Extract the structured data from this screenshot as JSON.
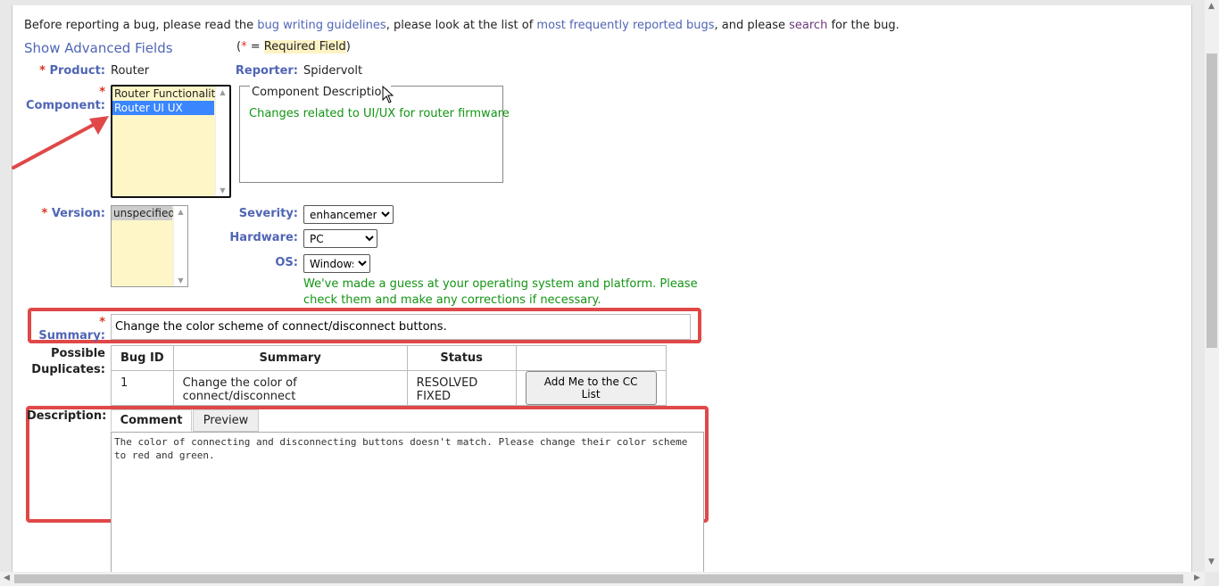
{
  "intro": {
    "t1": "Before reporting a bug, please read the ",
    "link_guidelines": "bug writing guidelines",
    "t2": ", please look at the list of ",
    "link_frequent": "most frequently reported bugs",
    "t3": ", and please ",
    "link_search": "search",
    "t4": " for the bug."
  },
  "show_advanced": "Show Advanced Fields",
  "required_note": {
    "open": "(",
    "star": "*",
    "eq": " = ",
    "text": "Required Field",
    "close": ")"
  },
  "product": {
    "star": "*",
    "label": "Product:",
    "value": "Router"
  },
  "reporter": {
    "label": "Reporter:",
    "value": "Spidervolt"
  },
  "component": {
    "star": "*",
    "label": "Component:",
    "options": [
      "Router Functionality",
      "Router UI UX"
    ],
    "selected": "Router UI UX"
  },
  "component_description": {
    "legend": "Component Description",
    "text": "Changes related to UI/UX for router firmware"
  },
  "version": {
    "star": "*",
    "label": "Version:",
    "options": [
      "unspecified"
    ]
  },
  "severity": {
    "label": "Severity:",
    "value": "enhancement"
  },
  "hardware": {
    "label": "Hardware:",
    "value": "PC"
  },
  "os": {
    "label": "OS:",
    "value": "Windows"
  },
  "guess_note": "We've made a guess at your operating system and platform. Please check them and make any corrections if necessary.",
  "summary": {
    "star": "*",
    "label": "Summary:",
    "value": "Change the color scheme of connect/disconnect buttons."
  },
  "duplicates": {
    "label_line1": "Possible",
    "label_line2": "Duplicates:",
    "headers": [
      "Bug ID",
      "Summary",
      "Status",
      ""
    ],
    "rows": [
      {
        "id": "1",
        "summary": "Change the color of connect/disconnect",
        "status": "RESOLVED FIXED",
        "action": "Add Me to the CC List"
      }
    ]
  },
  "description": {
    "label": "Description:",
    "tabs": [
      "Comment",
      "Preview"
    ],
    "comment": "The color of connecting and disconnecting buttons doesn't match. Please change their color scheme to red and green."
  },
  "colors": {
    "link": "#5065b5",
    "required": "#d32222",
    "highlight_box": "#e04848",
    "note_green": "#139413"
  }
}
